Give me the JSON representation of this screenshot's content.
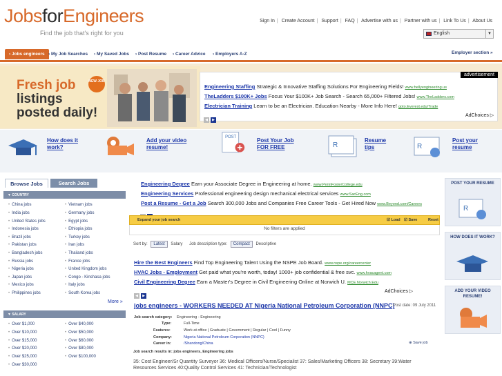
{
  "header": {
    "logo_part1": "Jobs",
    "logo_part2": "for",
    "logo_part3": "Engineers",
    "tagline": "Find the job that's right for you",
    "top_links": [
      "Sign In",
      "Create Account",
      "Support",
      "FAQ",
      "Advertise with us",
      "Partner with us",
      "Link To Us",
      "About Us"
    ],
    "language": "English",
    "language_icon": "uk-flag-icon"
  },
  "nav": {
    "items": [
      "Jobs engineers",
      "My Job Searches",
      "My Saved Jobs",
      "Post Resume",
      "Career Advice",
      "Employers A-Z"
    ],
    "employer_section": "Employer section",
    "accent_color": "#d7692a"
  },
  "banner": {
    "fresh_line1": "Fresh job",
    "fresh_line2": "listings",
    "fresh_line3": "posted daily!",
    "new_badge": "NEW JOB",
    "ad_label": "advertisement",
    "ads": [
      {
        "title": "Engineering Staffing",
        "text": "Strategic & Innovative Staffing Solutions For Engineering Fields!",
        "url": "www.hellyengineering.us"
      },
      {
        "title": "TheLadders $100K+ Jobs",
        "text": "Focus Your $100K+ Job Search - Search 65,000+ Filtered Jobs!",
        "url": "www.TheLadders.com"
      },
      {
        "title": "Electrician Training",
        "text": "Learn to be an Electrician. Education Nearby - More Info Here!",
        "url": "goto.Everest.edu/Trade"
      }
    ],
    "adchoices": "AdChoices"
  },
  "features": [
    {
      "line1": "How does it",
      "line2": "work?",
      "icon": "graduation-cap-icon"
    },
    {
      "line1": "Add your video",
      "line2": "resume!",
      "icon": "video-camera-icon"
    },
    {
      "line1": "Post Your Job",
      "line2": "FOR FREE",
      "icon": "post-document-icon"
    },
    {
      "line1": "Resume",
      "line2": "tips",
      "icon": "resume-document-icon"
    },
    {
      "line1": "Post your",
      "line2": "resume",
      "icon": "resume-upload-icon"
    }
  ],
  "sidebar": {
    "tab_browse": "Browse Jobs",
    "tab_search": "Search Jobs",
    "country_header": "COUNTRY",
    "countries_left": [
      "China jobs",
      "India jobs",
      "United States jobs",
      "Indonesia jobs",
      "Brazil jobs",
      "Pakistan jobs",
      "Bangladesh jobs",
      "Russia jobs",
      "Nigeria jobs",
      "Japan jobs",
      "Mexico jobs",
      "Philippines jobs"
    ],
    "countries_right": [
      "Vietnam jobs",
      "Germany jobs",
      "Egypt jobs",
      "Ethiopia jobs",
      "Turkey jobs",
      "Iran jobs",
      "Thailand jobs",
      "France jobs",
      "United Kingdom jobs",
      "Congo - Kinshasa jobs",
      "Italy jobs",
      "South Korea jobs"
    ],
    "more": "More »",
    "salary_header": "SALARY",
    "salary_left": [
      "Over $1,000",
      "Over $10,000",
      "Over $15,000",
      "Over $20,000",
      "Over $25,000",
      "Over $30,000"
    ],
    "salary_right": [
      "Over $40,000",
      "Over $50,000",
      "Over $60,000",
      "Over $80,000",
      "Over $100,000"
    ]
  },
  "center": {
    "ads": [
      {
        "title": "Engineering Degree",
        "text": "Earn your Associate Degree in Engineering at home.",
        "url": "www.PennFosterCollege.edu"
      },
      {
        "title": "Engineering Services",
        "text": "Professional engineering design mechanical electrical services",
        "url": "www.SacEng.com"
      },
      {
        "title": "Post a Resume - Get a Job",
        "text": "Search 300,000 Jobs and Companies Free Career Tools - Get Hired Now",
        "url": "www.Beyond.com/Careers"
      }
    ],
    "expand_label": "Expand your job search",
    "load_label": "Load",
    "save_label": "Save",
    "reset_label": "Reset",
    "no_filters": "No filters are applied",
    "sort_by": "Sort by:",
    "sort_latest": "Latest",
    "sort_salary": "Salary",
    "desc_type": "Job description type:",
    "desc_compact": "Compact",
    "desc_descriptive": "Descriptive",
    "ads2": [
      {
        "title": "Hire the Best Engineers",
        "text": "Find Top Engineering Talent Using the NSPE Job Board.",
        "url": "www.nspe.org/careercenter"
      },
      {
        "title": "HVAC Jobs - Employment",
        "text": "Get paid what you're worth, today! 1000+ job confidential & free svc.",
        "url": "www.hvacagent.com"
      },
      {
        "title": "Civil Engineering Degree",
        "text": "Earn a Master's Degree in Civil Engineering Online at Norwich U.",
        "url": "MCE.Norwich.Edu"
      }
    ],
    "adchoices": "AdChoices",
    "job": {
      "title": "jobs engineers -  WORKERS NEEDED AT Nigeria National Petroleum Corporation (NNPC)",
      "post_date": "Post date: 09 July 2011",
      "category_label": "Job search category:",
      "category": "Engineering - Engineering",
      "type_label": "Type:",
      "type": "Full-Time",
      "features_label": "Features:",
      "features": "Work at office | Graduate | Government | Regular | Cool | Funny",
      "company_label": "Company:",
      "company": "Nigeria National Petroleum Corporation (NNPC)",
      "career_label": "Career in:",
      "career": "/Shandong/China",
      "save_job": "Save job",
      "results_label": "Job search results in: jobs engineers, Engineering jobs",
      "description": "35: Cost Engineer/Sr Quantity Surveyor 36: Medical Officers/Nurse/Specialist 37: Sales/Marketing Officers 38: Secretary 39:Water Resources Services 40:Quality Control Services 41: Technician/Technologist"
    }
  },
  "right": {
    "cards": [
      {
        "title": "POST YOUR RESUME",
        "icon": "resume-card-icon"
      },
      {
        "title": "HOW DOES IT WORK?",
        "icon": "graduation-cap-icon"
      },
      {
        "title": "ADD YOUR VIDEO RESUME!",
        "icon": "video-camera-icon"
      }
    ]
  }
}
